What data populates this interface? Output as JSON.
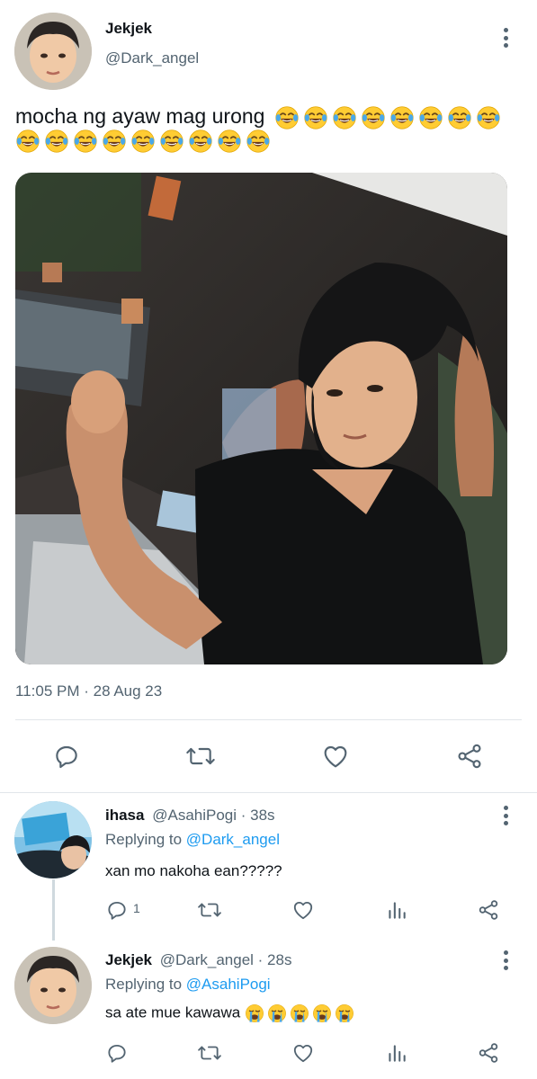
{
  "tweet": {
    "author_name": "Jekjek",
    "author_handle": "@Dark_angel",
    "text": "mocha ng ayaw mag urong",
    "emoji_count_line1": 8,
    "emoji_count_line2": 9,
    "emoji_name": "face-with-tears-of-joy",
    "time": "11:05 PM",
    "date": "28 Aug 23",
    "separator": " · "
  },
  "replies": [
    {
      "author_name": "ihasa",
      "author_handle": "@AsahiPogi",
      "age": "38s",
      "replying_prefix": "Replying to ",
      "replying_to": "@Dark_angel",
      "text": "xan mo nakoha ean?????",
      "reply_count": "1"
    },
    {
      "author_name": "Jekjek",
      "author_handle": "@Dark_angel",
      "age": "28s",
      "replying_prefix": "Replying to ",
      "replying_to": "@AsahiPogi",
      "text": "sa ate mue kawawa",
      "emoji_count": 5,
      "emoji_name": "loudly-crying-face"
    }
  ],
  "colors": {
    "text": "#0f1419",
    "muted": "#536471",
    "accent": "#1d9bf0",
    "divider": "#e1e6ea",
    "thread_line": "#cfd9de"
  },
  "icons": [
    "reply-icon",
    "retweet-icon",
    "like-icon",
    "share-icon",
    "analytics-icon",
    "more-icon"
  ]
}
